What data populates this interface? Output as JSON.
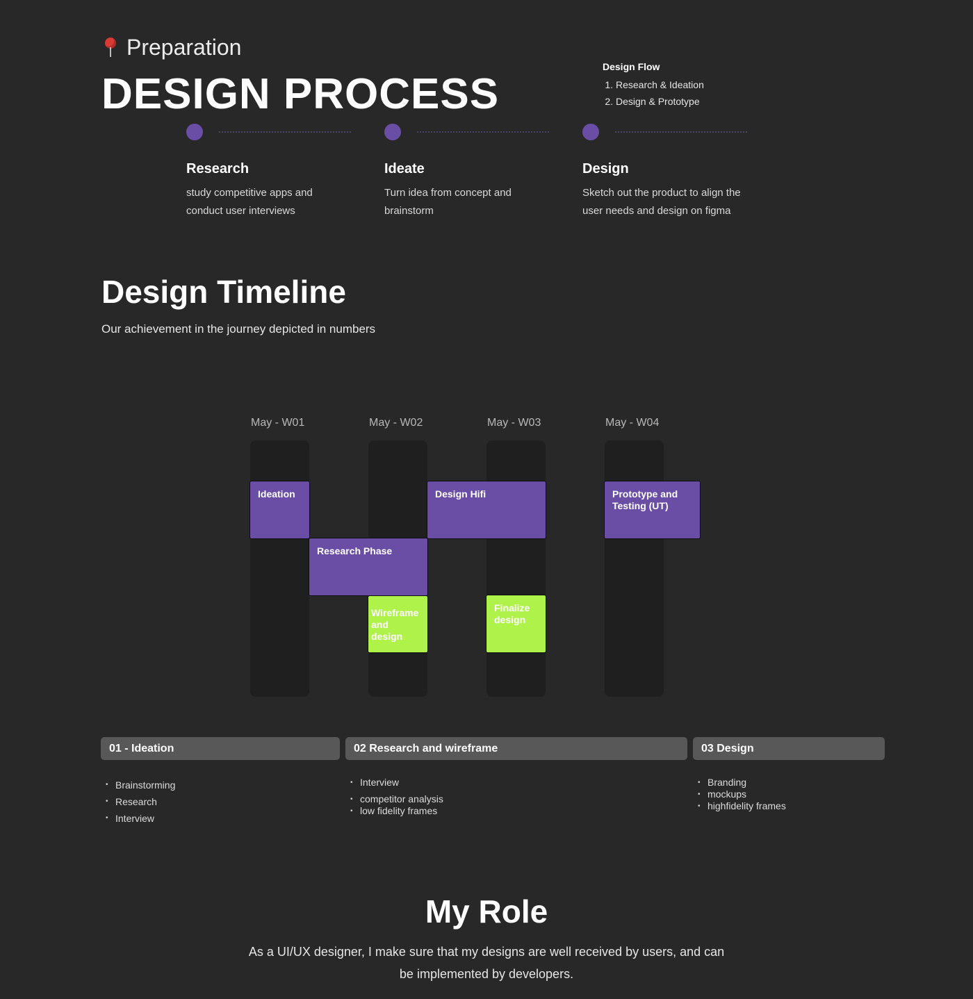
{
  "header": {
    "preparation_label": "Preparation",
    "title": "DESIGN PROCESS"
  },
  "design_flow": {
    "heading": "Design Flow",
    "items": [
      "Research & Ideation",
      "Design & Prototype"
    ]
  },
  "steps": [
    {
      "title": "Research",
      "desc_line1": "study competitive apps and",
      "desc_line2": "conduct user interviews"
    },
    {
      "title": "Ideate",
      "desc_line1": "Turn idea from concept and",
      "desc_line2": "brainstorm"
    },
    {
      "title": "Design",
      "desc_line1": "Sketch out the product to align the",
      "desc_line2": "user needs and design on figma"
    }
  ],
  "timeline": {
    "title": "Design Timeline",
    "subtitle": "Our achievement in the journey depicted in numbers",
    "weeks": [
      "May - W01",
      "May - W02",
      "May - W03",
      "May - W04"
    ],
    "tasks": {
      "ideation": "Ideation",
      "research_phase": "Research Phase",
      "design_hifi": "Design Hifi",
      "prototype_line1": "Prototype  and",
      "prototype_line2": "Testing (UT)",
      "wireframe_line1": "Wireframe",
      "wireframe_line2": "and",
      "wireframe_line3": "design",
      "finalize_line1": "Finalize",
      "finalize_line2": "design"
    },
    "colors": {
      "purple": "#6a4ea6",
      "green": "#aef24a",
      "column": "#1f1f1f"
    }
  },
  "phases": [
    {
      "label": "01 - Ideation",
      "items": [
        "Brainstorming",
        "Research",
        "Interview"
      ]
    },
    {
      "label": "02  Research and wireframe",
      "items": [
        "Interview",
        "competitor analysis",
        "low fidelity frames"
      ]
    },
    {
      "label": "03 Design",
      "items": [
        "Branding",
        "mockups",
        "highfidelity frames"
      ]
    }
  ],
  "role": {
    "title": "My Role",
    "line1": "As a UI/UX designer, I make sure that my designs are well received by users, and can",
    "line2": "be implemented by developers."
  }
}
